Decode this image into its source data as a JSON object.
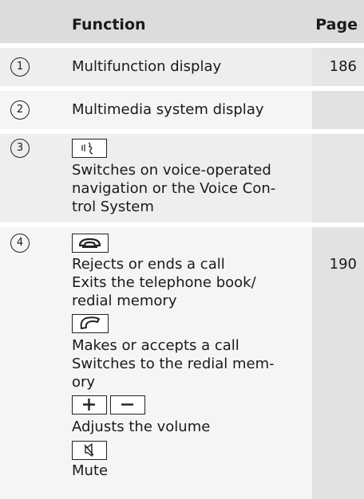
{
  "header": {
    "function": "Function",
    "page": "Page"
  },
  "rows": [
    {
      "number": "1",
      "lines": [
        "Multifunction display"
      ],
      "page": "186"
    },
    {
      "number": "2",
      "lines": [
        "Multimedia system display"
      ],
      "page": ""
    },
    {
      "number": "3",
      "lines": [
        "Switches on voice-operated",
        "navigation or the Voice Con-",
        "trol System"
      ],
      "page": ""
    },
    {
      "number": "4",
      "page": "190",
      "items": [
        {
          "icon": "end-call-key-icon",
          "lines": [
            "Rejects or ends a call",
            "Exits the telephone book/",
            "redial memory"
          ]
        },
        {
          "icon": "call-key-icon",
          "lines": [
            "Makes or accepts a call",
            "Switches to the redial mem-",
            "ory"
          ]
        },
        {
          "icon": "volume-plus-minus-icon",
          "lines": [
            "Adjusts the volume"
          ]
        },
        {
          "icon": "mute-key-icon",
          "lines": [
            "Mute"
          ]
        }
      ]
    }
  ],
  "colors": {
    "header_bg": "#dcdcdc",
    "row_bg": "#eeeeee",
    "page_col_bg": "#e2e2e2"
  }
}
